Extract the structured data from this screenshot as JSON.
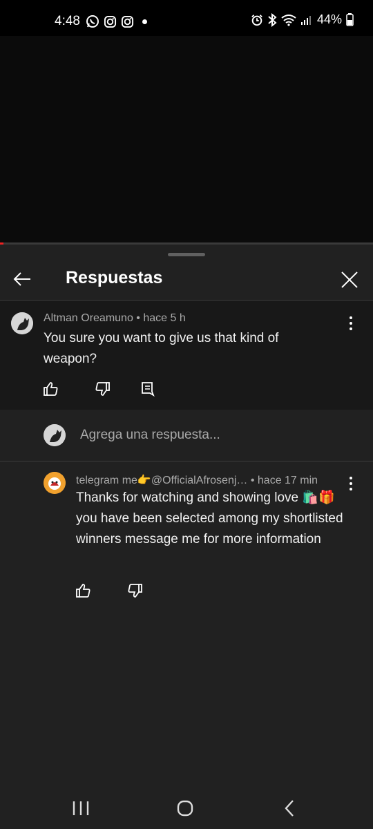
{
  "status_bar": {
    "time": "4:48",
    "battery": "44%"
  },
  "video": {
    "progress_fraction": 0.01
  },
  "panel": {
    "title": "Respuestas"
  },
  "parent_comment": {
    "author": "Altman Oreamuno",
    "time": "hace 5 h",
    "text": "You sure you want to give us that kind of weapon?"
  },
  "reply_input": {
    "placeholder": "Agrega una respuesta..."
  },
  "reply": {
    "author": "telegram me👉@OfficialAfrosenj…",
    "time": "hace 17 min",
    "text": "Thanks for watching and showing love 🛍️🎁you have been selected among my shortlisted winners message me for more information"
  },
  "colors": {
    "sheet_bg": "#212121",
    "parent_bg": "#181818",
    "progress": "#e22222"
  }
}
